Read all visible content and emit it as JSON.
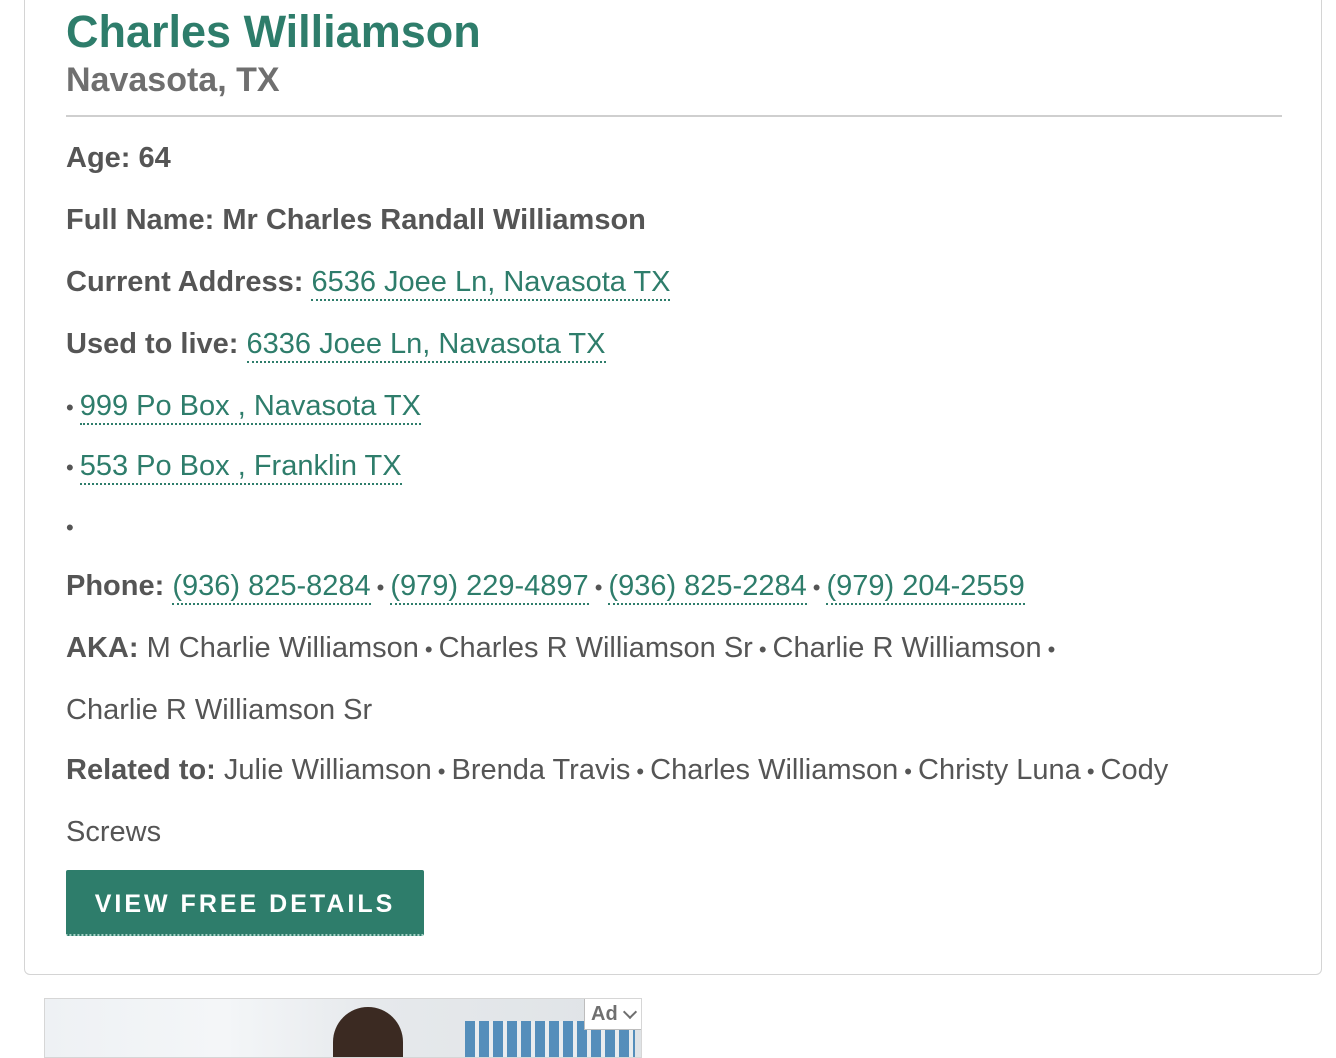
{
  "person": {
    "name": "Charles Williamson",
    "location": "Navasota, TX"
  },
  "details": {
    "age_label": "Age:",
    "age_value": "64",
    "full_name_label": "Full Name:",
    "full_name_value": "Mr Charles Randall Williamson",
    "current_address_label": "Current Address:",
    "current_address": "6536 Joee Ln, Navasota TX",
    "used_to_live_label": "Used to live:",
    "previous_addresses": [
      "6336 Joee Ln, Navasota TX",
      "999 Po Box , Navasota TX",
      "553 Po Box , Franklin TX"
    ],
    "phone_label": "Phone:",
    "phones": [
      "(936) 825-8284",
      "(979) 229-4897",
      "(936) 825-2284",
      "(979) 204-2559"
    ],
    "aka_label": "AKA:",
    "aka": [
      "M Charlie Williamson",
      "Charles R Williamson Sr",
      "Charlie R Williamson",
      "Charlie R Williamson Sr"
    ],
    "related_label": "Related to:",
    "related": [
      "Julie Williamson",
      "Brenda Travis",
      "Charles Williamson",
      "Christy Luna",
      "Cody",
      "Screws"
    ],
    "separator": "•"
  },
  "cta": {
    "button_label": "VIEW FREE DETAILS"
  },
  "ad": {
    "badge_label": "Ad",
    "badge_icon": "chevron-down-icon"
  },
  "colors": {
    "accent": "#2e7d6b",
    "text": "#555555",
    "muted": "#6f6f6f",
    "border": "#d4d4d4"
  }
}
